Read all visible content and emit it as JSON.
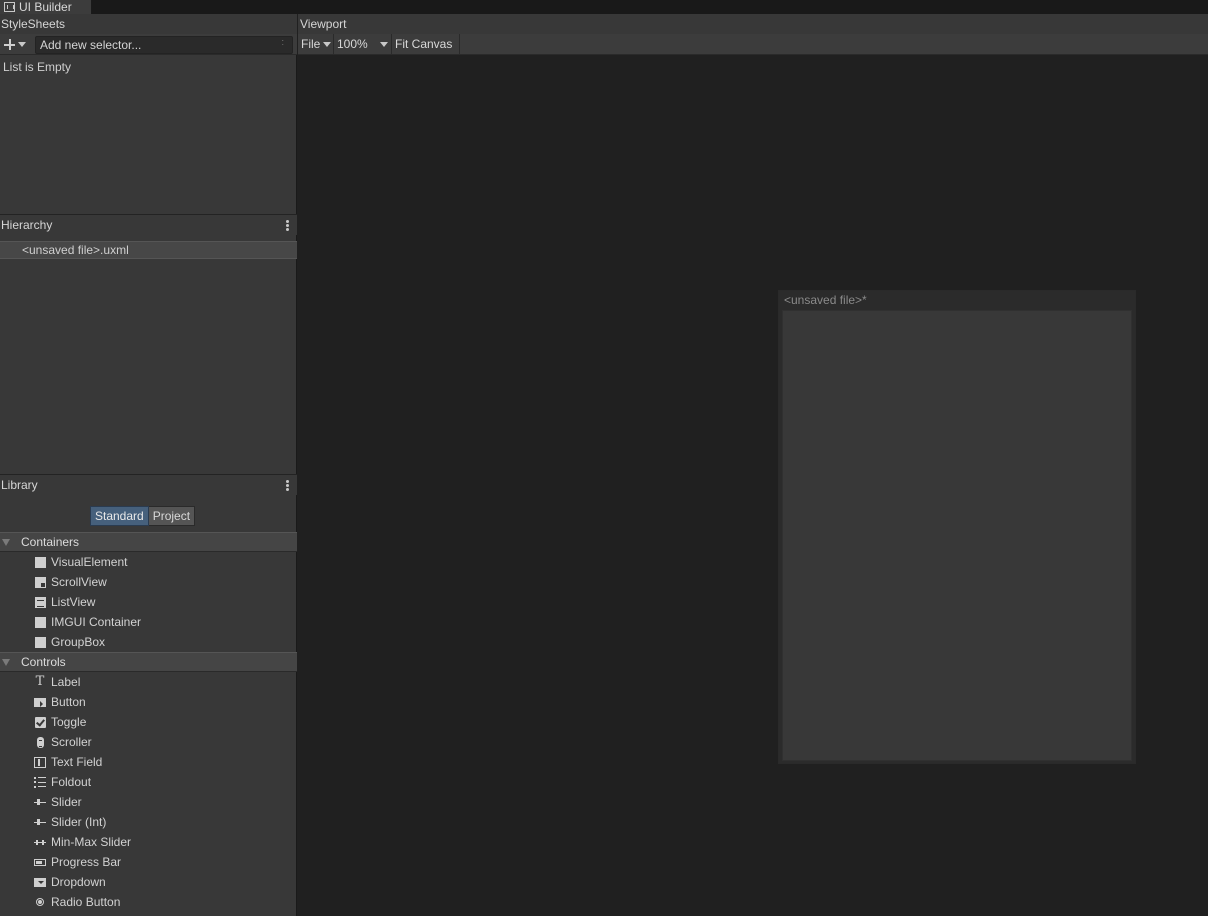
{
  "window": {
    "tab_title": "UI Builder"
  },
  "stylesheets": {
    "header": "StyleSheets",
    "selector_placeholder": "Add new selector...",
    "selector_dots": ":",
    "empty_text": "List is Empty"
  },
  "hierarchy": {
    "header": "Hierarchy",
    "root_item": "<unsaved file>.uxml"
  },
  "library": {
    "header": "Library",
    "tabs": [
      {
        "label": "Standard",
        "active": true
      },
      {
        "label": "Project",
        "active": false
      }
    ],
    "groups": [
      {
        "label": "Containers",
        "items": [
          {
            "label": "VisualElement",
            "icon": "visual-element-icon"
          },
          {
            "label": "ScrollView",
            "icon": "scroll-view-icon"
          },
          {
            "label": "ListView",
            "icon": "list-view-icon"
          },
          {
            "label": "IMGUI Container",
            "icon": "imgui-container-icon"
          },
          {
            "label": "GroupBox",
            "icon": "group-box-icon"
          }
        ]
      },
      {
        "label": "Controls",
        "items": [
          {
            "label": "Label",
            "icon": "label-icon"
          },
          {
            "label": "Button",
            "icon": "button-icon"
          },
          {
            "label": "Toggle",
            "icon": "toggle-icon"
          },
          {
            "label": "Scroller",
            "icon": "scroller-icon"
          },
          {
            "label": "Text Field",
            "icon": "text-field-icon"
          },
          {
            "label": "Foldout",
            "icon": "foldout-icon"
          },
          {
            "label": "Slider",
            "icon": "slider-icon"
          },
          {
            "label": "Slider (Int)",
            "icon": "slider-int-icon"
          },
          {
            "label": "Min-Max Slider",
            "icon": "min-max-slider-icon"
          },
          {
            "label": "Progress Bar",
            "icon": "progress-bar-icon"
          },
          {
            "label": "Dropdown",
            "icon": "dropdown-icon"
          },
          {
            "label": "Radio Button",
            "icon": "radio-button-icon"
          }
        ]
      }
    ]
  },
  "viewport": {
    "header": "Viewport",
    "toolbar": {
      "file_label": "File",
      "zoom_value": "100%",
      "fit_label": "Fit Canvas"
    },
    "canvas_title": "<unsaved file>*"
  },
  "colors": {
    "panel_bg": "#383838",
    "viewport_bg": "#202020",
    "active_tab": "#46607c"
  }
}
